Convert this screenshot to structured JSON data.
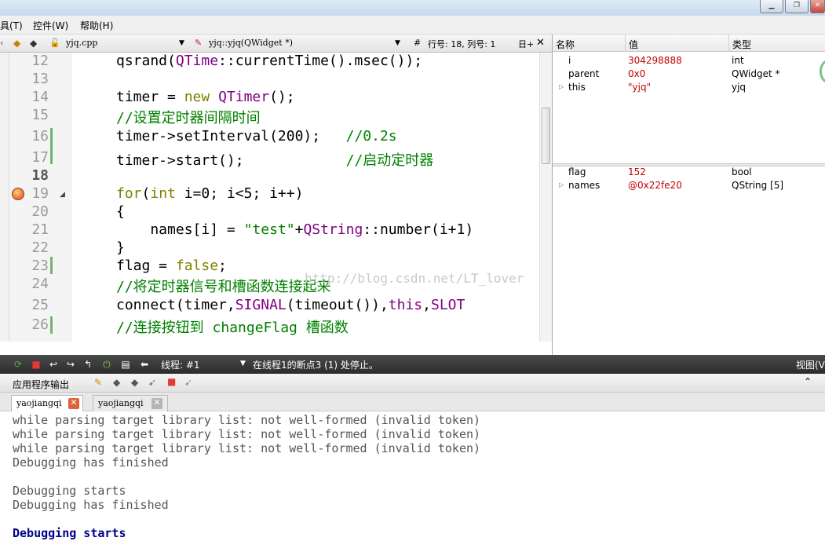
{
  "menu": [
    "具(T)",
    "控件(W)",
    "帮助(H)"
  ],
  "editor_header": {
    "file": "yjq.cpp",
    "symbol": "yjq::yjq(QWidget *)",
    "hash": "#",
    "position": "行号: 18, 列号: 1"
  },
  "code_lines": [
    {
      "n": "12",
      "html": "qsrand(<span class=\"cls\">QTime</span>::currentTime().msec());"
    },
    {
      "n": "13",
      "html": ""
    },
    {
      "n": "14",
      "html": "timer = <span class=\"kw\">new</span> <span class=\"cls\">QTimer</span>();"
    },
    {
      "n": "15",
      "html": "<span class=\"cmt\">//设置定时器间隔时间</span>"
    },
    {
      "n": "16",
      "html": "timer-&gt;setInterval(200);   <span class=\"cmt\">//0.2s</span>"
    },
    {
      "n": "17",
      "html": "timer-&gt;start();            <span class=\"cmt\">//启动定时器</span>"
    },
    {
      "n": "18",
      "html": ""
    },
    {
      "n": "19",
      "html": "<span class=\"kw\">for</span>(<span class=\"kw\">int</span> i=0; i&lt;5; i++)"
    },
    {
      "n": "20",
      "html": "{"
    },
    {
      "n": "21",
      "html": "    names[i] = <span class=\"str\">\"test\"</span>+<span class=\"cls\">QString</span>::number(i+1)"
    },
    {
      "n": "22",
      "html": "}"
    },
    {
      "n": "23",
      "html": "flag = <span class=\"kw\">false</span>;"
    },
    {
      "n": "24",
      "html": "<span class=\"cmt\">//将定时器信号和槽函数连接起来</span>"
    },
    {
      "n": "25",
      "html": "connect(timer,<span class=\"cls\">SIGNAL</span>(timeout()),<span class=\"cls\">this</span>,<span class=\"cls\">SLOT</span>"
    },
    {
      "n": "26",
      "html": "<span class=\"cmt\">//连接按钮到 changeFlag 槽函数</span>"
    }
  ],
  "watermark": "http://blog.csdn.net/LT_lover",
  "locals": {
    "headers": [
      "名称",
      "值",
      "类型"
    ],
    "rows": [
      {
        "name": "i",
        "value": "304298888",
        "type": "int",
        "expandable": false
      },
      {
        "name": "parent",
        "value": "0x0",
        "type": "QWidget *",
        "expandable": false
      },
      {
        "name": "this",
        "value": "\"yjq\"",
        "type": "yjq",
        "expandable": true
      }
    ],
    "rows2": [
      {
        "name": "flag",
        "value": "152",
        "type": "bool",
        "expandable": false
      },
      {
        "name": "names",
        "value": "@0x22fe20",
        "type": "QString [5]",
        "expandable": true
      }
    ]
  },
  "debugbar": {
    "thread_label": "线程: #1",
    "status": "在线程1的断点3 (1) 处停止。",
    "view": "视图(V"
  },
  "output_panel": {
    "title": "应用程序输出",
    "tabs": [
      "yaojiangqi",
      "yaojiangqi"
    ]
  },
  "output_lines": [
    {
      "text": "while parsing target library list: not well-formed (invalid token)",
      "style": "normal"
    },
    {
      "text": "while parsing target library list: not well-formed (invalid token)",
      "style": "normal"
    },
    {
      "text": "while parsing target library list: not well-formed (invalid token)",
      "style": "normal"
    },
    {
      "text": "Debugging has finished",
      "style": "normal"
    },
    {
      "text": "",
      "style": "normal"
    },
    {
      "text": "Debugging starts",
      "style": "normal"
    },
    {
      "text": "Debugging has finished",
      "style": "normal"
    },
    {
      "text": "",
      "style": "normal"
    },
    {
      "text": "Debugging starts",
      "style": "blue"
    }
  ],
  "colors": {
    "keyword": "#808000",
    "class": "#800080",
    "comment": "#008000",
    "value": "#c00000",
    "output_blue": "#00008b"
  }
}
